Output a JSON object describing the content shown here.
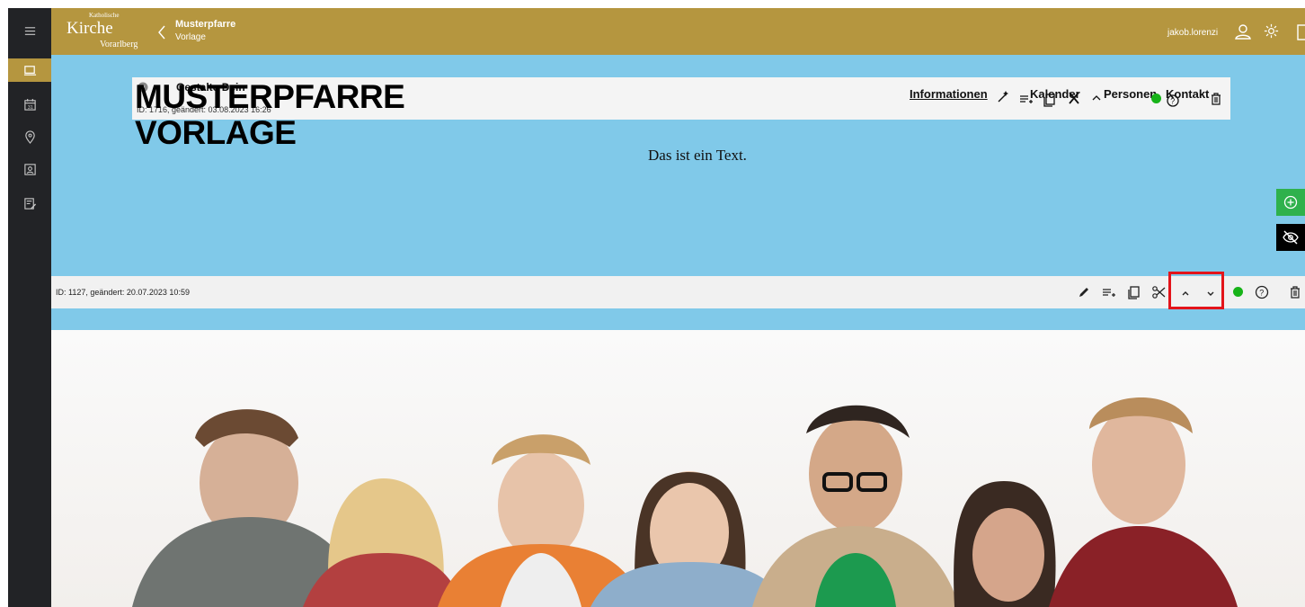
{
  "header": {
    "logo": {
      "line1": "Katholische",
      "line2": "Kirche",
      "line3": "Vorarlberg"
    },
    "title": "Musterpfarre",
    "subtitle": "Vorlage",
    "user": "jakob.lorenzi"
  },
  "sidebar": {
    "items": [
      {
        "icon": "menu-icon"
      },
      {
        "icon": "monitor-icon",
        "active": true
      },
      {
        "icon": "calendar-icon"
      },
      {
        "icon": "location-pin-icon"
      },
      {
        "icon": "contact-card-icon"
      },
      {
        "icon": "edit-document-icon"
      }
    ]
  },
  "page": {
    "site_title": "MUSTERPFARRE\nVORLAGE",
    "overlay_label": "Gestalte Dein",
    "overlay_id": "ID: 1716, geändert: 03.08.2023 16:26",
    "nav_links": [
      "Informationen",
      "Kalender",
      "Personen",
      "Kontakt"
    ],
    "text": "Das ist ein Text."
  },
  "module": {
    "id_text": "ID: 1127, geändert: 20.07.2023 10:59"
  },
  "colors": {
    "header_gold": "#b5963f",
    "sidebar_dark": "#222326",
    "content_blue": "#80c9e9",
    "status_green": "#17b319",
    "highlight_red": "#e3141a",
    "add_green": "#2fb14c"
  }
}
